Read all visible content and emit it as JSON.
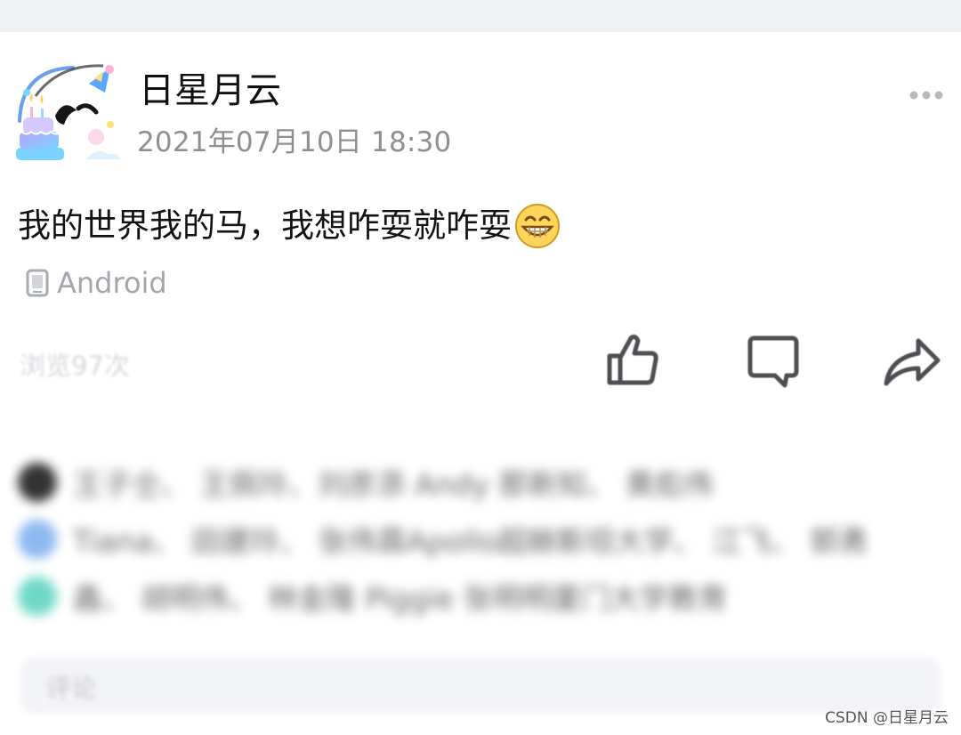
{
  "post": {
    "author_name": "日星月云",
    "timestamp": "2021年07月10日 18:30",
    "text": "我的世界我的马，我想咋耍就咋耍",
    "device": "Android",
    "views": "浏览97次",
    "emoji_icon": "grinning-face-icon"
  },
  "avatar": {
    "decor_text": "Happy Birthday"
  },
  "actions": {
    "like_icon": "thumbs-up-icon",
    "comment_icon": "comment-icon",
    "share_icon": "share-icon",
    "more_icon": "more-icon"
  },
  "likes": {
    "lines": [
      "王子仝、 王佩玲、刘彦添 Andy 那新知、 黄彪伟",
      "Tiana、 田建玲、 张伟霖Apollo超赫斯坦大学、 江飞、 郭勇",
      "鑫、 胡明伟、 林金隆 Piggie 张明明厦门大学教育"
    ]
  },
  "comment": {
    "placeholder": "评论"
  },
  "watermark": "CSDN @日星月云",
  "colors": {
    "top_bar": "#eef0f4",
    "secondary_text": "#8f8f8f",
    "icon_gray": "#4d4f53"
  }
}
